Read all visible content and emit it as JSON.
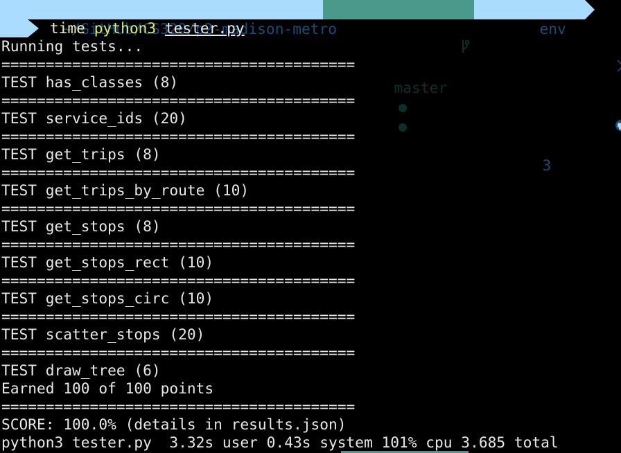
{
  "prompt": {
    "path": "~/GitHub/CS320/p2-madison-metro",
    "branch": "master",
    "env": "env",
    "github_count": "3",
    "branch_icon": "git-branch-icon",
    "github_icon": "github-icon",
    "colors": {
      "path_bg": "#a9dcff",
      "git_bg": "#4a9a8b"
    }
  },
  "command": {
    "time": "time",
    "program": "python3",
    "arg": "tester.py"
  },
  "output": {
    "running": "Running tests...",
    "separator": "========================================",
    "tests": [
      "TEST has_classes (8)",
      "TEST service_ids (20)",
      "TEST get_trips (8)",
      "TEST get_trips_by_route (10)",
      "TEST get_stops (8)",
      "TEST get_stops_rect (10)",
      "TEST get_stops_circ (10)",
      "TEST scatter_stops (20)",
      "TEST draw_tree (6)"
    ],
    "earned": "Earned 100 of 100 points",
    "score": "SCORE: 100.0% (details in results.json)",
    "timing": "python3 tester.py  3.32s user 0.43s system 101% cpu 3.685 total"
  }
}
